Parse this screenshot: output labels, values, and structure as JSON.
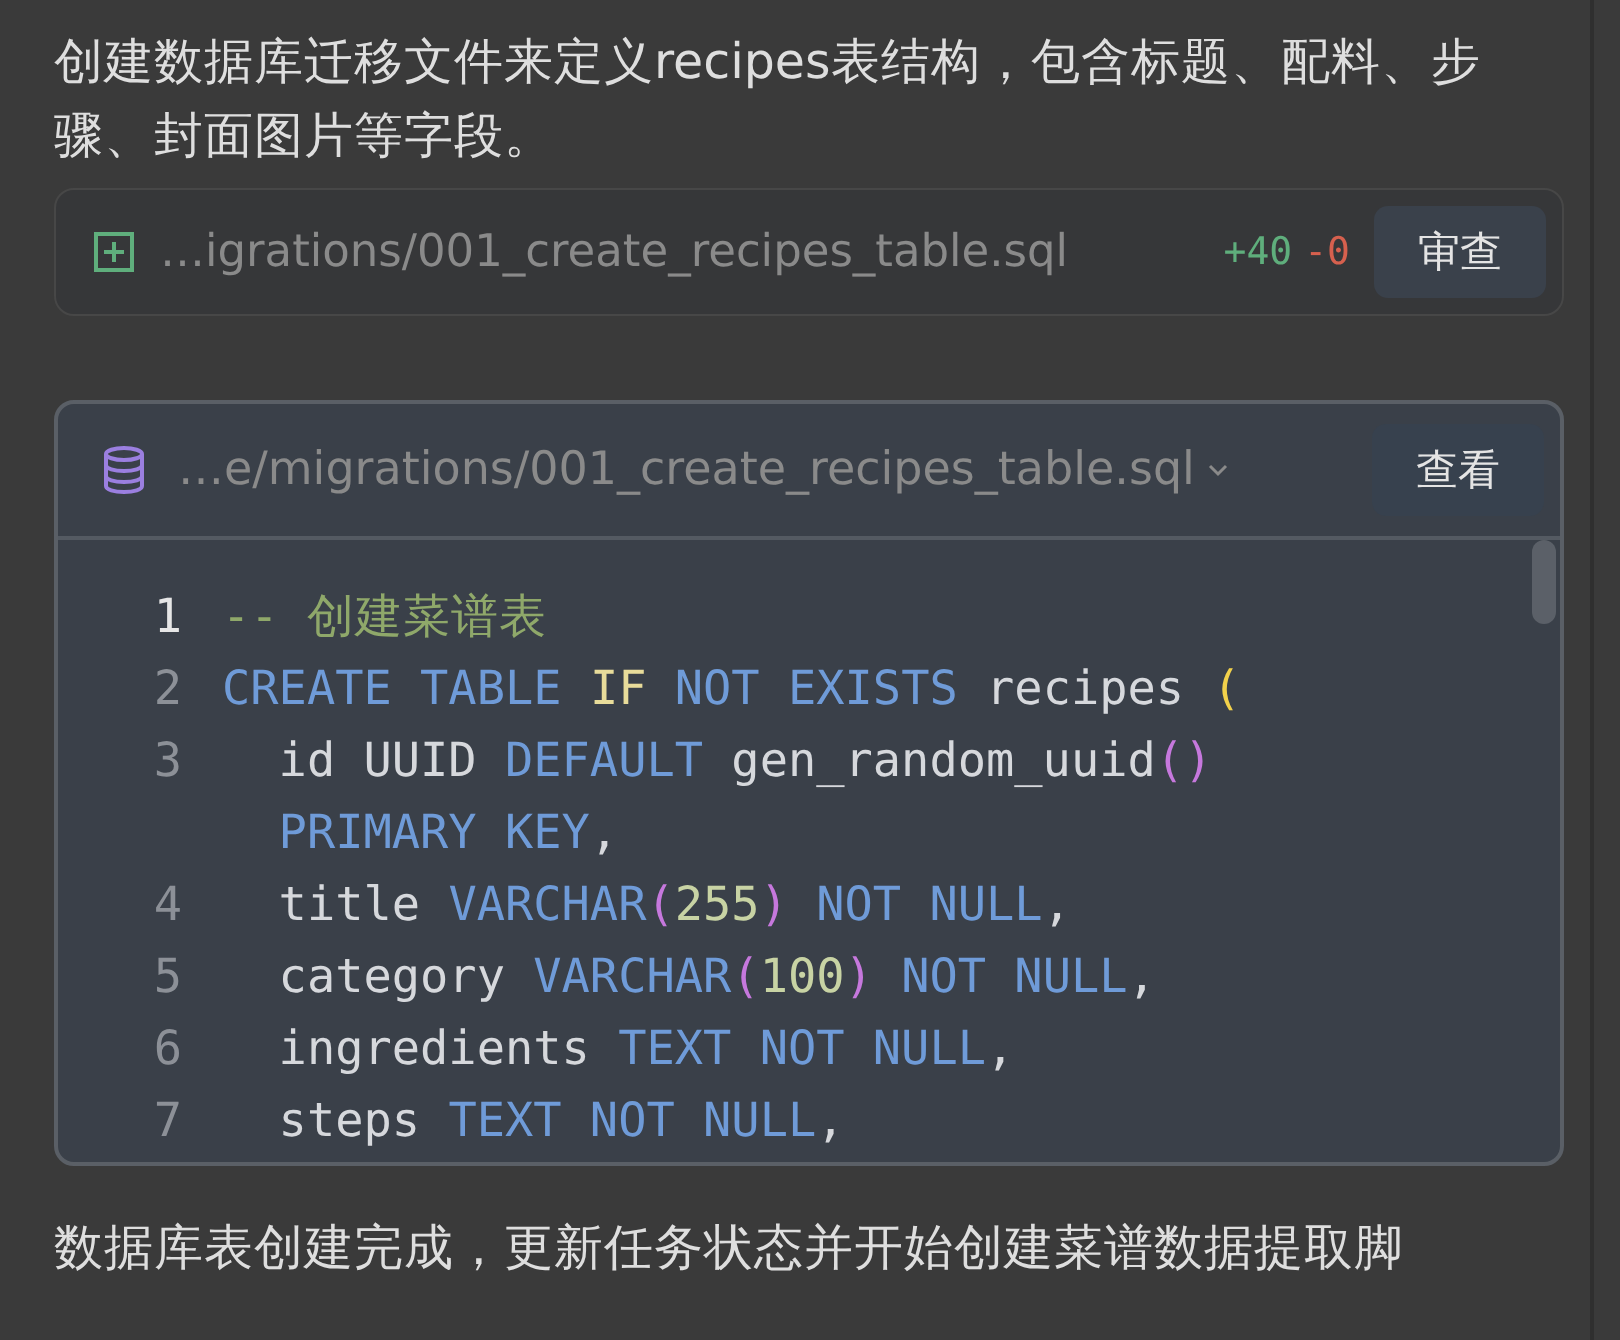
{
  "intro": "创建数据库迁移文件来定义recipes表结构，包含标题、配料、步骤、封面图片等字段。",
  "diff_card": {
    "path": "…igrations/001_create_recipes_table.sql",
    "added": "+40",
    "removed": "-0",
    "button": "审查"
  },
  "code_card": {
    "path": "…e/migrations/001_create_recipes_table.sql",
    "button": "查看",
    "lines": [
      {
        "number": "1",
        "current": true,
        "tokens": [
          {
            "t": "-- 创建菜谱表",
            "kind": "comment"
          }
        ]
      },
      {
        "number": "2",
        "current": false,
        "tokens": [
          {
            "t": "CREATE TABLE ",
            "kind": "keyword"
          },
          {
            "t": "IF ",
            "kind": "conditional"
          },
          {
            "t": "NOT EXISTS ",
            "kind": "keyword"
          },
          {
            "t": "recipes ",
            "kind": "text"
          },
          {
            "t": "(",
            "kind": "paren_gold"
          }
        ]
      },
      {
        "number": "3",
        "current": false,
        "tokens": [
          {
            "t": "  id UUID ",
            "kind": "text"
          },
          {
            "t": "DEFAULT ",
            "kind": "keyword"
          },
          {
            "t": "gen_random_uuid",
            "kind": "text"
          },
          {
            "t": "()",
            "kind": "paren_violet"
          }
        ]
      },
      {
        "tokens": [
          {
            "t": "  PRIMARY KEY",
            "kind": "keyword"
          },
          {
            "t": ",",
            "kind": "text"
          }
        ]
      },
      {
        "number": "4",
        "current": false,
        "tokens": [
          {
            "t": "  title ",
            "kind": "text"
          },
          {
            "t": "VARCHAR",
            "kind": "keyword"
          },
          {
            "t": "(",
            "kind": "paren_violet"
          },
          {
            "t": "255",
            "kind": "number"
          },
          {
            "t": ") ",
            "kind": "paren_violet"
          },
          {
            "t": "NOT NULL",
            "kind": "keyword"
          },
          {
            "t": ",",
            "kind": "text"
          }
        ]
      },
      {
        "number": "5",
        "current": false,
        "tokens": [
          {
            "t": "  category ",
            "kind": "text"
          },
          {
            "t": "VARCHAR",
            "kind": "keyword"
          },
          {
            "t": "(",
            "kind": "paren_violet"
          },
          {
            "t": "100",
            "kind": "number"
          },
          {
            "t": ") ",
            "kind": "paren_violet"
          },
          {
            "t": "NOT NULL",
            "kind": "keyword"
          },
          {
            "t": ",",
            "kind": "text"
          }
        ]
      },
      {
        "number": "6",
        "current": false,
        "tokens": [
          {
            "t": "  ingredients ",
            "kind": "text"
          },
          {
            "t": "TEXT NOT NULL",
            "kind": "keyword"
          },
          {
            "t": ",",
            "kind": "text"
          }
        ]
      },
      {
        "number": "7",
        "current": false,
        "tokens": [
          {
            "t": "  steps ",
            "kind": "text"
          },
          {
            "t": "TEXT NOT NULL",
            "kind": "keyword"
          },
          {
            "t": ",",
            "kind": "text"
          }
        ]
      }
    ]
  },
  "outro": "数据库表创建完成，更新任务状态并开始创建菜谱数据提取脚"
}
